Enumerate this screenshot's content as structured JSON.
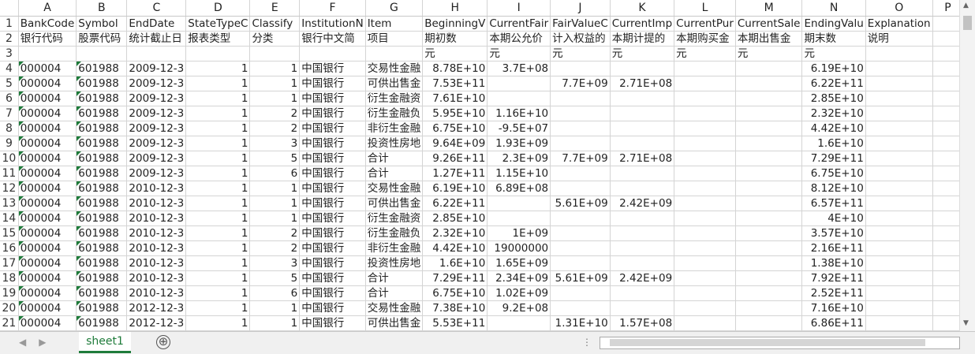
{
  "columns": [
    "A",
    "B",
    "C",
    "D",
    "E",
    "F",
    "G",
    "H",
    "I",
    "J",
    "K",
    "L",
    "M",
    "N",
    "O",
    "P"
  ],
  "partial_column": "(",
  "rows": [
    [
      "BankCode",
      "Symbol",
      "EndDate",
      "StateTypeC",
      "Classify",
      "InstitutionN",
      "Item",
      "BeginningV",
      "CurrentFair",
      "FairValueC",
      "CurrentImp",
      "CurrentPur",
      "CurrentSale",
      "EndingValu",
      "Explanation",
      ""
    ],
    [
      "银行代码",
      "股票代码",
      "统计截止日",
      "报表类型",
      "分类",
      "银行中文简",
      "项目",
      "期初数",
      "本期公允价",
      "计入权益的",
      "本期计提的",
      "本期购买金",
      "本期出售金",
      "期末数",
      "说明",
      ""
    ],
    [
      "",
      "",
      "",
      "",
      "",
      "",
      "",
      "元",
      "元",
      "元",
      "元",
      "元",
      "元",
      "元",
      "",
      ""
    ],
    [
      "000004",
      "601988",
      "2009-12-3",
      "1",
      "1",
      "中国银行",
      "交易性金融",
      "8.78E+10",
      "3.7E+08",
      "",
      "",
      "",
      "",
      "6.19E+10",
      "",
      ""
    ],
    [
      "000004",
      "601988",
      "2009-12-3",
      "1",
      "1",
      "中国银行",
      "可供出售金",
      "7.53E+11",
      "",
      "7.7E+09",
      "2.71E+08",
      "",
      "",
      "6.22E+11",
      "",
      ""
    ],
    [
      "000004",
      "601988",
      "2009-12-3",
      "1",
      "1",
      "中国银行",
      "衍生金融资",
      "7.61E+10",
      "",
      "",
      "",
      "",
      "",
      "2.85E+10",
      "",
      ""
    ],
    [
      "000004",
      "601988",
      "2009-12-3",
      "1",
      "2",
      "中国银行",
      "衍生金融负",
      "5.95E+10",
      "1.16E+10",
      "",
      "",
      "",
      "",
      "2.32E+10",
      "",
      ""
    ],
    [
      "000004",
      "601988",
      "2009-12-3",
      "1",
      "2",
      "中国银行",
      "非衍生金融",
      "6.75E+10",
      "-9.5E+07",
      "",
      "",
      "",
      "",
      "4.42E+10",
      "",
      ""
    ],
    [
      "000004",
      "601988",
      "2009-12-3",
      "1",
      "3",
      "中国银行",
      "投资性房地",
      "9.64E+09",
      "1.93E+09",
      "",
      "",
      "",
      "",
      "1.6E+10",
      "",
      ""
    ],
    [
      "000004",
      "601988",
      "2009-12-3",
      "1",
      "5",
      "中国银行",
      "合计",
      "9.26E+11",
      "2.3E+09",
      "7.7E+09",
      "2.71E+08",
      "",
      "",
      "7.29E+11",
      "",
      ""
    ],
    [
      "000004",
      "601988",
      "2009-12-3",
      "1",
      "6",
      "中国银行",
      "合计",
      "1.27E+11",
      "1.15E+10",
      "",
      "",
      "",
      "",
      "6.75E+10",
      "",
      ""
    ],
    [
      "000004",
      "601988",
      "2010-12-3",
      "1",
      "1",
      "中国银行",
      "交易性金融",
      "6.19E+10",
      "6.89E+08",
      "",
      "",
      "",
      "",
      "8.12E+10",
      "",
      ""
    ],
    [
      "000004",
      "601988",
      "2010-12-3",
      "1",
      "1",
      "中国银行",
      "可供出售金",
      "6.22E+11",
      "",
      "5.61E+09",
      "2.42E+09",
      "",
      "",
      "6.57E+11",
      "",
      ""
    ],
    [
      "000004",
      "601988",
      "2010-12-3",
      "1",
      "1",
      "中国银行",
      "衍生金融资",
      "2.85E+10",
      "",
      "",
      "",
      "",
      "",
      "4E+10",
      "",
      ""
    ],
    [
      "000004",
      "601988",
      "2010-12-3",
      "1",
      "2",
      "中国银行",
      "衍生金融负",
      "2.32E+10",
      "1E+09",
      "",
      "",
      "",
      "",
      "3.57E+10",
      "",
      ""
    ],
    [
      "000004",
      "601988",
      "2010-12-3",
      "1",
      "2",
      "中国银行",
      "非衍生金融",
      "4.42E+10",
      "19000000",
      "",
      "",
      "",
      "",
      "2.16E+11",
      "",
      ""
    ],
    [
      "000004",
      "601988",
      "2010-12-3",
      "1",
      "3",
      "中国银行",
      "投资性房地",
      "1.6E+10",
      "1.65E+09",
      "",
      "",
      "",
      "",
      "1.38E+10",
      "",
      ""
    ],
    [
      "000004",
      "601988",
      "2010-12-3",
      "1",
      "5",
      "中国银行",
      "合计",
      "7.29E+11",
      "2.34E+09",
      "5.61E+09",
      "2.42E+09",
      "",
      "",
      "7.92E+11",
      "",
      ""
    ],
    [
      "000004",
      "601988",
      "2010-12-3",
      "1",
      "6",
      "中国银行",
      "合计",
      "6.75E+10",
      "1.02E+09",
      "",
      "",
      "",
      "",
      "2.52E+11",
      "",
      ""
    ],
    [
      "000004",
      "601988",
      "2012-12-3",
      "1",
      "1",
      "中国银行",
      "交易性金融",
      "7.38E+10",
      "9.2E+08",
      "",
      "",
      "",
      "",
      "7.16E+10",
      "",
      ""
    ],
    [
      "000004",
      "601988",
      "2012-12-3",
      "1",
      "1",
      "中国银行",
      "可供出售金",
      "5.53E+11",
      "",
      "1.31E+10",
      "1.57E+08",
      "",
      "",
      "6.86E+11",
      "",
      ""
    ]
  ],
  "numeric_columns": [
    3,
    4,
    7,
    8,
    9,
    10,
    11,
    12,
    13
  ],
  "sheet_tab": "sheet1",
  "add_sheet_symbol": "⊕",
  "scroll_dots": "⋮",
  "accent_color": "#1e7b3a"
}
